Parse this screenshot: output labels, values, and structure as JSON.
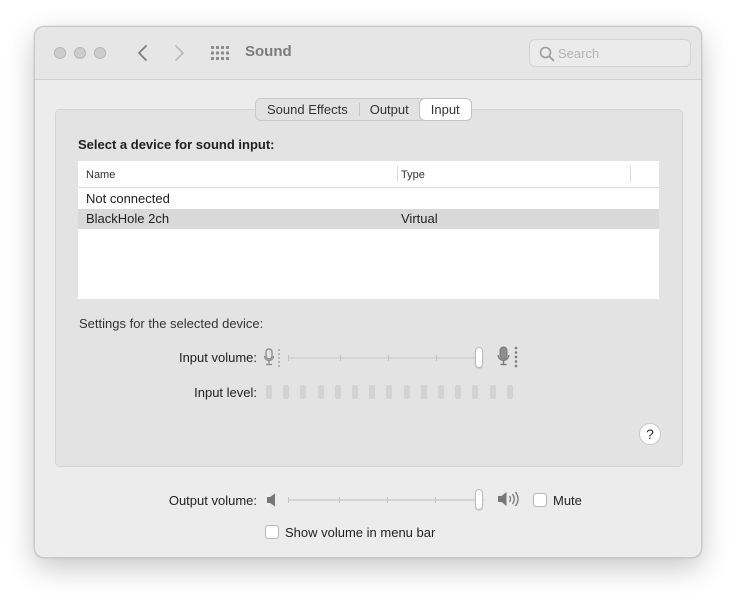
{
  "window": {
    "title": "Sound"
  },
  "search": {
    "placeholder": "Search"
  },
  "tabs": [
    {
      "label": "Sound Effects",
      "active": false
    },
    {
      "label": "Output",
      "active": false
    },
    {
      "label": "Input",
      "active": true
    }
  ],
  "input_panel": {
    "section_title": "Select a device for sound input:",
    "columns": [
      "Name",
      "Type"
    ],
    "devices": [
      {
        "name": "Not connected",
        "type": "",
        "selected": false
      },
      {
        "name": "BlackHole 2ch",
        "type": "Virtual",
        "selected": true
      }
    ],
    "settings_label": "Settings for the selected device:",
    "input_volume_label": "Input volume:",
    "input_volume_fraction": 1.0,
    "input_level_label": "Input level:",
    "input_level_segments_lit": 0,
    "help_label": "?"
  },
  "output": {
    "volume_label": "Output volume:",
    "volume_fraction": 1.0,
    "mute_label": "Mute",
    "mute_checked": false,
    "show_volume_label": "Show volume in menu bar",
    "show_volume_checked": false
  },
  "icons": {
    "back": "chevron-left-icon",
    "forward": "chevron-right-icon",
    "grid": "grid-icon",
    "search": "magnifier-icon",
    "mic_low": "microphone-low-icon",
    "mic_high": "microphone-high-icon",
    "speaker_low": "speaker-low-icon",
    "speaker_high": "speaker-high-icon"
  }
}
